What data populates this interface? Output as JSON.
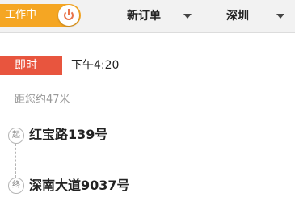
{
  "status": {
    "label": "工作中",
    "on": true,
    "color": "#f5a623",
    "icon": "power-icon"
  },
  "filters": {
    "order_type": "新订单",
    "city": "深圳"
  },
  "order": {
    "tag": "即时",
    "tag_color": "#e8553e",
    "time": "下午4:20",
    "distance": "距您约47米",
    "start": {
      "marker": "起",
      "address": "红宝路139号"
    },
    "end": {
      "marker": "终",
      "address": "深南大道9037号"
    }
  }
}
